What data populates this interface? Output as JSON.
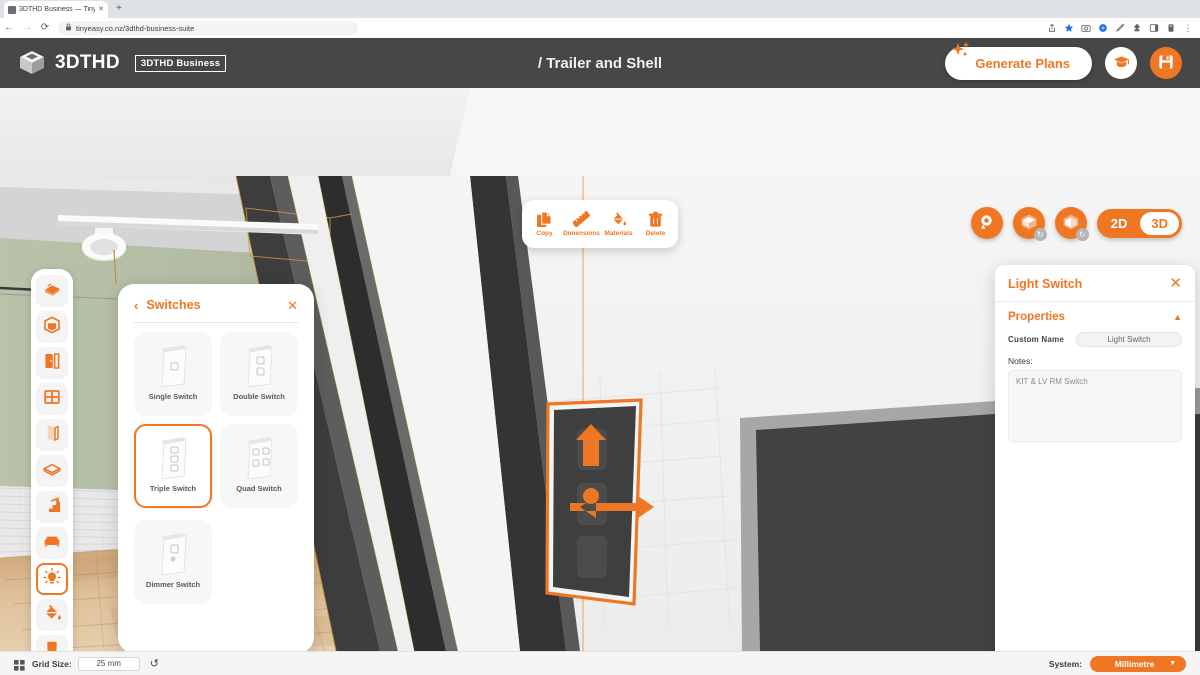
{
  "browser": {
    "tab_title": "3DTHD Business — Tiny Easy - T",
    "tab_close": "✕",
    "new_tab": "+",
    "back": "←",
    "forward": "→",
    "reload": "⟳",
    "lock": "🔒",
    "url": "tinyeasy.co.nz/3dthd-business-suite",
    "toolbar_icons": [
      "share-icon",
      "bookmark-star-icon",
      "camera-icon",
      "blue-circle-icon",
      "highlighter-icon",
      "extensions-icon",
      "side-panel-icon",
      "profile-icon",
      "more-menu-icon"
    ],
    "more_menu": "⋮"
  },
  "header": {
    "brand_name": "3DTHD",
    "brand_badge": "3DTHD Business",
    "title": "/ Trailer and Shell",
    "generate_plans_label": "Generate Plans",
    "tutorial_icon": "graduation-cap-icon",
    "save_icon": "save-disk-icon",
    "accent": "#ef7723",
    "bar_color": "#474747"
  },
  "object_toolbar": {
    "items": [
      {
        "label": "Copy",
        "icon": "copy-icon"
      },
      {
        "label": "Dimensions",
        "icon": "ruler-icon"
      },
      {
        "label": "Materials",
        "icon": "paint-bucket-icon"
      },
      {
        "label": "Delete",
        "icon": "trash-icon"
      }
    ]
  },
  "view_controls": {
    "buttons": [
      {
        "name": "camera-view-button",
        "icon": "camera-orbit-icon",
        "badge": ""
      },
      {
        "name": "roof-toggle-button",
        "icon": "roof-icon",
        "badge": "↻"
      },
      {
        "name": "walls-toggle-button",
        "icon": "walls-icon",
        "badge": "↻"
      }
    ],
    "dimension_options": [
      "2D",
      "3D"
    ],
    "dimension_active": "3D"
  },
  "tool_rail": {
    "items": [
      {
        "name": "sidebar-item-site",
        "icon": "site-ground-icon",
        "active": false
      },
      {
        "name": "sidebar-item-room",
        "icon": "room-box-icon",
        "active": false
      },
      {
        "name": "sidebar-item-doors",
        "icon": "door-icon",
        "active": false
      },
      {
        "name": "sidebar-item-windows",
        "icon": "window-icon",
        "active": false
      },
      {
        "name": "sidebar-item-walls",
        "icon": "wall-icon",
        "active": false
      },
      {
        "name": "sidebar-item-floors",
        "icon": "floor-slab-icon",
        "active": false
      },
      {
        "name": "sidebar-item-stairs",
        "icon": "stairs-icon",
        "active": false
      },
      {
        "name": "sidebar-item-furniture",
        "icon": "sofa-icon",
        "active": false
      },
      {
        "name": "sidebar-item-lighting",
        "icon": "lightbulb-icon",
        "active": true
      },
      {
        "name": "sidebar-item-materials",
        "icon": "paint-bucket-icon",
        "active": false
      },
      {
        "name": "sidebar-item-bookmarks",
        "icon": "bookmark-icon",
        "active": false
      }
    ]
  },
  "switch_panel": {
    "back_glyph": "‹",
    "title": "Switches",
    "close_glyph": "✕",
    "items": [
      {
        "label": "Single Switch",
        "rockers": 1,
        "dimmer": false,
        "selected": false
      },
      {
        "label": "Double Switch",
        "rockers": 2,
        "dimmer": false,
        "selected": false
      },
      {
        "label": "Triple Switch",
        "rockers": 3,
        "dimmer": false,
        "selected": true
      },
      {
        "label": "Quad Switch",
        "rockers": 4,
        "dimmer": false,
        "selected": false
      },
      {
        "label": "Dimmer Switch",
        "rockers": 1,
        "dimmer": true,
        "selected": false
      }
    ]
  },
  "properties_panel": {
    "title": "Light Switch",
    "close_glyph": "✕",
    "section_title": "Properties",
    "collapse_glyph": "▲",
    "custom_name_label": "Custom Name",
    "custom_name_value": "Light Switch",
    "custom_name_placeholder": "Light Switch",
    "notes_label": "Notes:",
    "notes_value": "KIT & LV RM Switch",
    "notes_placeholder": "Notes"
  },
  "status_bar": {
    "grid_icon": "grid-icon",
    "grid_size_label": "Grid Size:",
    "grid_size_value": "25 mm",
    "reset_glyph": "↺",
    "system_label": "System:",
    "system_value": "Millimetre",
    "system_caret": "▼"
  },
  "scene": {
    "description": "3D interior view of a tiny-home trailer shell with sage-green wall, white ceiling with track spotlight, light timber plank floor, dark steel frame posts, and a selected wall switch plate with orange move gizmo arrows",
    "wall_color": "#b7c1a9",
    "ceiling_color": "#ededed",
    "floor_color": "#dcbd95",
    "frame_color": "#3a3a3a",
    "selection_color": "#ef7723",
    "selected_object": "Light Switch"
  }
}
